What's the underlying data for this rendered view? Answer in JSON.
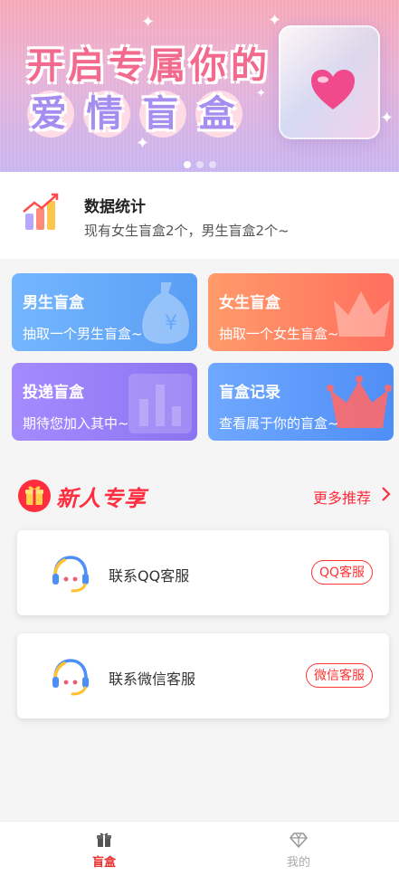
{
  "banner": {
    "line1": "开启专属你的",
    "line2": [
      "爱",
      "情",
      "盲",
      "盒"
    ],
    "carousel": {
      "count": 3,
      "active": 1
    }
  },
  "stats": {
    "title": "数据统计",
    "desc": "现有女生盲盒2个，男生盲盒2个~"
  },
  "cards": {
    "male": {
      "title": "男生盲盒",
      "desc": "抽取一个男生盲盒~",
      "icon": "money-bag-icon"
    },
    "female": {
      "title": "女生盲盒",
      "desc": "抽取一个女生盲盒~",
      "icon": "crown-icon"
    },
    "deliver": {
      "title": "投递盲盒",
      "desc": "期待您加入其中~",
      "icon": "bar-chart-icon"
    },
    "record": {
      "title": "盲盒记录",
      "desc": "查看属于你的盲盒~",
      "icon": "crown-icon"
    }
  },
  "section": {
    "title": "新人专享",
    "more": "更多推荐",
    "icon": "gift-icon"
  },
  "services": {
    "qq": {
      "label": "联系QQ客服",
      "button": "QQ客服",
      "icon": "headset-icon"
    },
    "wechat": {
      "label": "联系微信客服",
      "button": "微信客服",
      "icon": "headset-icon"
    }
  },
  "tabbar": {
    "box": {
      "label": "盲盒",
      "icon": "gift-icon"
    },
    "mine": {
      "label": "我的",
      "icon": "diamond-icon"
    }
  },
  "colors": {
    "accent": "#ff2d3e",
    "tab_active": "#e82c2c",
    "tab_inactive": "#aaaaaa"
  }
}
